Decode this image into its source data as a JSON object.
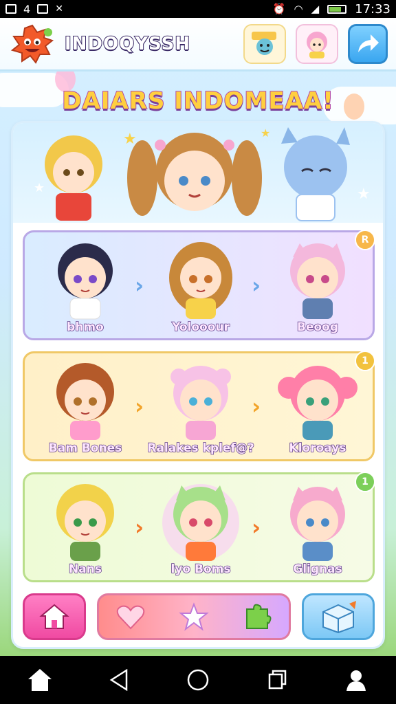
{
  "status_bar": {
    "time": "17:33",
    "left_icons": [
      "image-icon",
      "a-icon",
      "photo-icon",
      "cross-icon"
    ],
    "right_icons": [
      "alarm-icon",
      "wifi-icon",
      "signal-icon",
      "battery-icon"
    ]
  },
  "header": {
    "app_name": "INDOQYSSH",
    "buttons": [
      "friends-icon",
      "avatar-icon",
      "share-arrow-icon"
    ]
  },
  "banner": {
    "title": "DAIARS INDOMEAA!"
  },
  "rows": [
    {
      "badge": "R",
      "badge_color": "#f7b74a",
      "characters": [
        {
          "name": "bhmo",
          "hair": "#2b2b4a",
          "skin": "#ffe2cc",
          "shirt": "#ffffff"
        },
        {
          "name": "Yolooour",
          "hair": "#c8883a",
          "skin": "#ffe2cc",
          "shirt": "#f7d24a"
        },
        {
          "name": "Beoog",
          "hair": "#f4b8dc",
          "skin": "#ffe2cc",
          "shirt": "#5f7fb0"
        }
      ]
    },
    {
      "badge": "1",
      "badge_color": "#f2c23e",
      "characters": [
        {
          "name": "Bam Bones",
          "hair": "#b45a2a",
          "skin": "#ffe2cc",
          "shirt": "#ff9ccc"
        },
        {
          "name": "Ralakes kplef@?",
          "hair": "#f7c2e6",
          "skin": "#ffe2cc",
          "shirt": "#f7a6d4"
        },
        {
          "name": "Kloroays",
          "hair": "#ff7fa8",
          "skin": "#ffe2cc",
          "shirt": "#4a9ab8"
        }
      ]
    },
    {
      "badge": "1",
      "badge_color": "#7ccf5a",
      "characters": [
        {
          "name": "Nans",
          "hair": "#f2d24a",
          "skin": "#ffe2cc",
          "shirt": "#6aa04a"
        },
        {
          "name": "lyo Boms",
          "hair": "#a7e08a",
          "skin": "#ffe2cc",
          "shirt": "#ff7a3a"
        },
        {
          "name": "Glignas",
          "hair": "#f7aacd",
          "skin": "#ffe2cc",
          "shirt": "#5a8ec8"
        }
      ]
    }
  ],
  "toolbar": {
    "home": "home-icon",
    "middle": [
      "heart-icon",
      "star-icon",
      "puzzle-icon"
    ],
    "right": "box-icon"
  },
  "nav": [
    "home-nav-icon",
    "back-icon",
    "circle-home-icon",
    "recents-icon",
    "profile-icon"
  ],
  "colors": {
    "accent_blue": "#3aa6f0",
    "accent_pink": "#f04aa2",
    "banner_yellow": "#ffcf3f"
  }
}
